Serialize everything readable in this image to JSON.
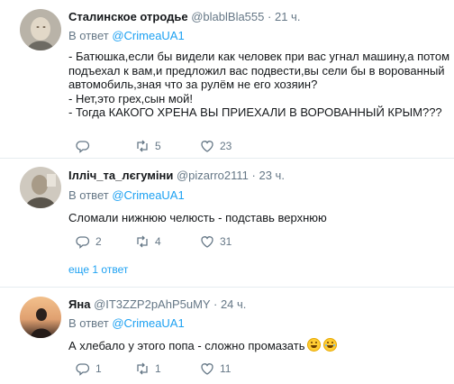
{
  "tweets": [
    {
      "name": "Сталинское отродье",
      "handle": "@blablBla555",
      "dot": "·",
      "time": "21 ч.",
      "reply_prefix": "В ответ",
      "reply_mention": "@CrimeaUA1",
      "lines": [
        "- Батюшка,если бы видели как человек при вас угнал машину,а потом",
        "подъехал к вам,и предложил вас подвести,вы сели бы в ворованный",
        "автомобиль,зная что за рулём не его хозяин?",
        "- Нет,это грех,сын мой!",
        "- Тогда КАКОГО ХРЕНА ВЫ ПРИЕХАЛИ В ВОРОВАННЫЙ КРЫМ???"
      ],
      "reply_count": "",
      "retweet_count": "5",
      "like_count": "23"
    },
    {
      "name": "Ілліч_та_лєгуміни",
      "handle": "@pizarro2111",
      "dot": "·",
      "time": "23 ч.",
      "reply_prefix": "В ответ",
      "reply_mention": "@CrimeaUA1",
      "lines": [
        "Сломали нижнюю челюсть - подставь верхнюю"
      ],
      "reply_count": "2",
      "retweet_count": "4",
      "like_count": "31",
      "more_replies": "еще 1 ответ"
    },
    {
      "name": "Яна",
      "handle": "@IT3ZZP2pAhP5uMY",
      "dot": "·",
      "time": "24 ч.",
      "reply_prefix": "В ответ",
      "reply_mention": "@CrimeaUA1",
      "lines": [
        "А хлебало у этого попа - сложно промазать"
      ],
      "emojis": [
        "grinning-sweat-emoji",
        "tears-of-joy-emoji"
      ],
      "reply_count": "1",
      "retweet_count": "1",
      "like_count": "11"
    }
  ],
  "icons": {
    "reply": "reply-icon",
    "retweet": "retweet-icon",
    "like": "heart-icon"
  },
  "colors": {
    "link": "#1da1f2",
    "muted": "#657786",
    "text": "#14171a",
    "divider": "#e6ecf0"
  }
}
